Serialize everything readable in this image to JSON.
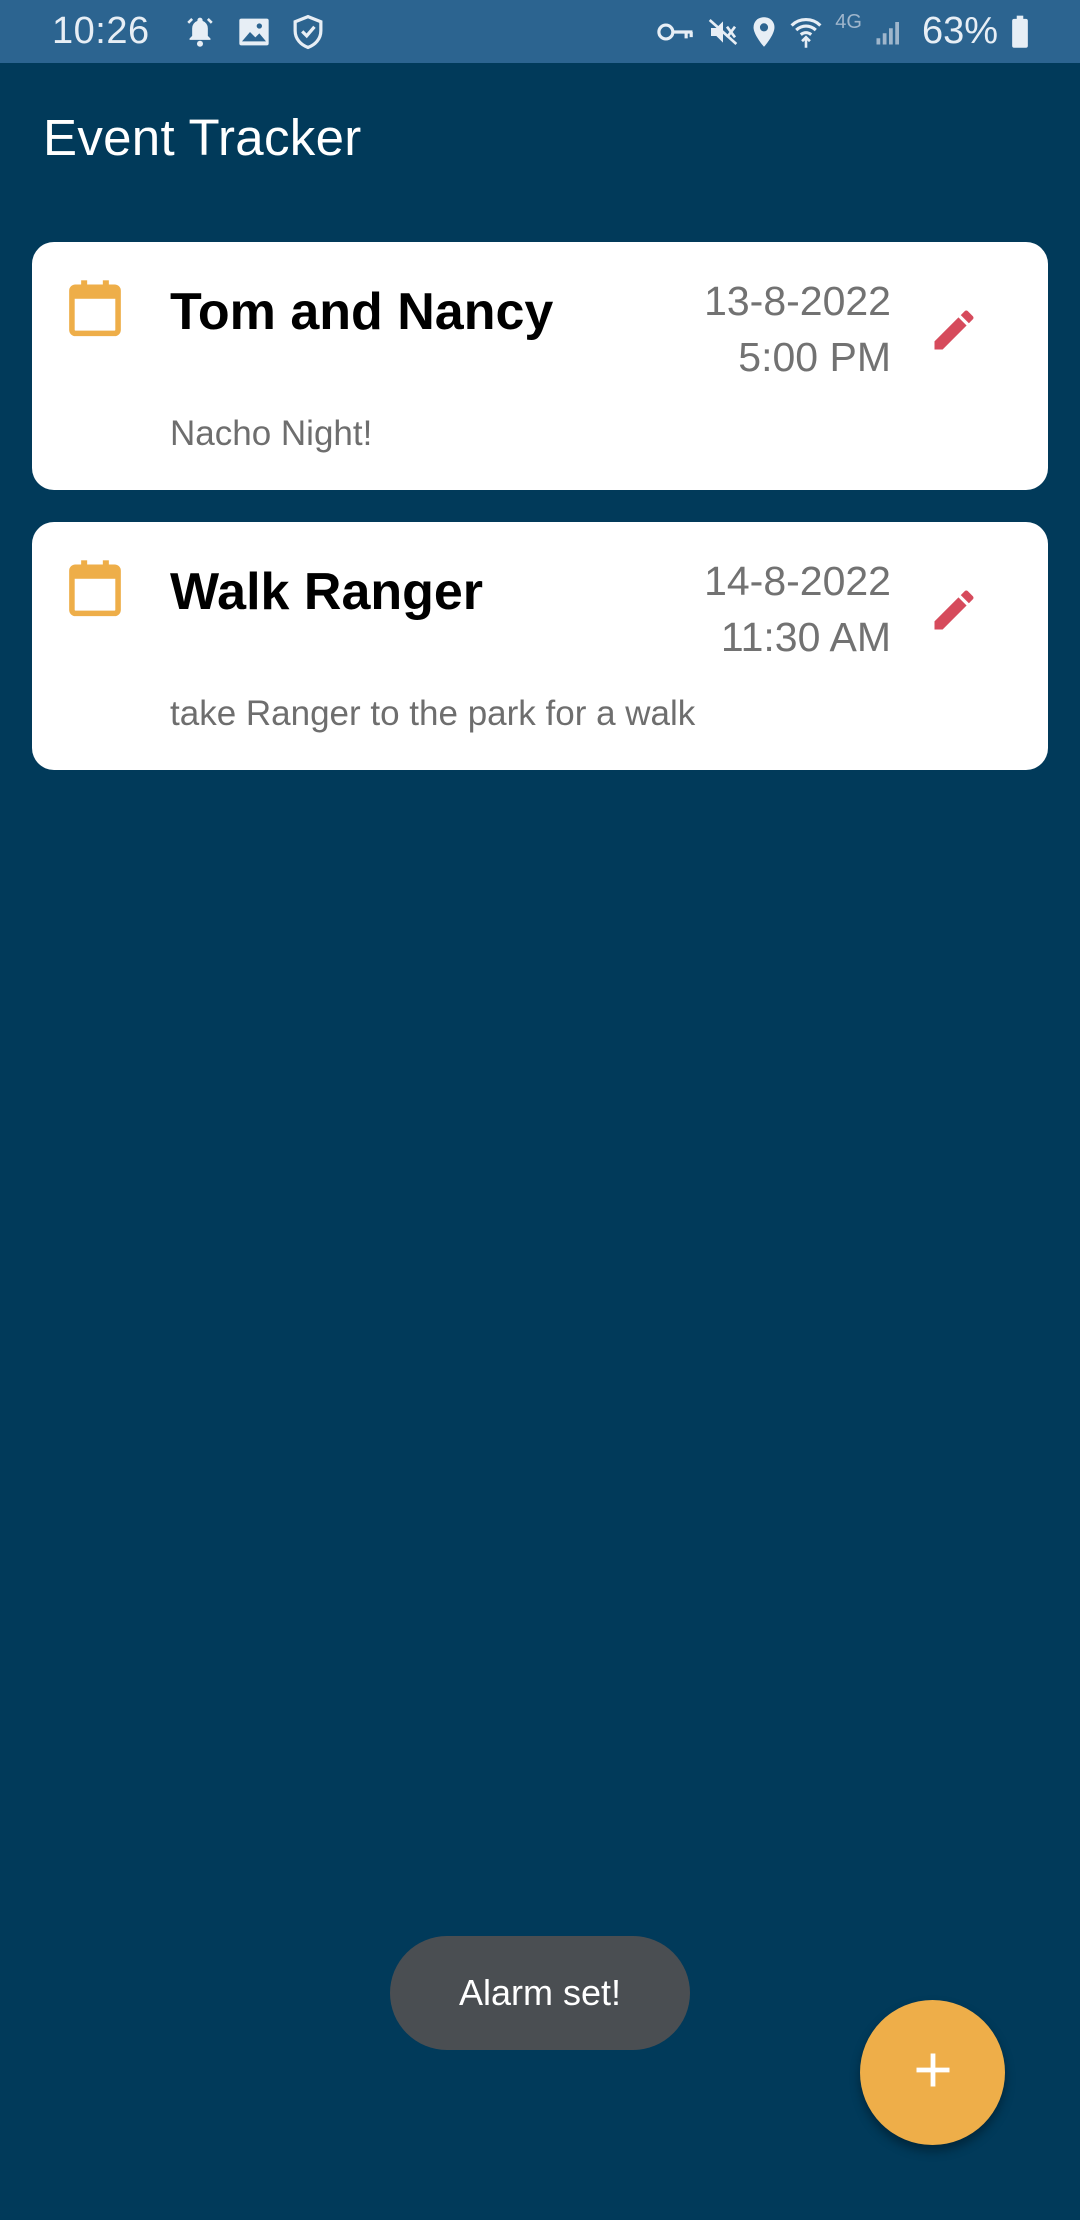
{
  "status_bar": {
    "time": "10:26",
    "battery": "63%",
    "network": "4G",
    "icons_left": [
      "alarm-icon",
      "image-icon",
      "shield-icon"
    ],
    "icons_right": [
      "key-icon",
      "mute-icon",
      "location-icon",
      "wifi-icon",
      "signal-icon",
      "battery-icon"
    ]
  },
  "app_bar": {
    "title": "Event Tracker"
  },
  "events": [
    {
      "title": "Tom and Nancy",
      "date": "13-8-2022",
      "time": "5:00 PM",
      "description": "Nacho Night!"
    },
    {
      "title": "Walk Ranger",
      "date": "14-8-2022",
      "time": "11:30 AM",
      "description": "take Ranger to the park for a walk"
    }
  ],
  "toast": {
    "message": "Alarm set!"
  },
  "fab": {
    "icon": "plus-icon"
  },
  "colors": {
    "background": "#013a5a",
    "status_bar": "#2c6490",
    "card": "#ffffff",
    "calendar_icon": "#eeae49",
    "edit_icon": "#d64b5c",
    "fab": "#eeae49",
    "toast": "#4a4e52"
  }
}
